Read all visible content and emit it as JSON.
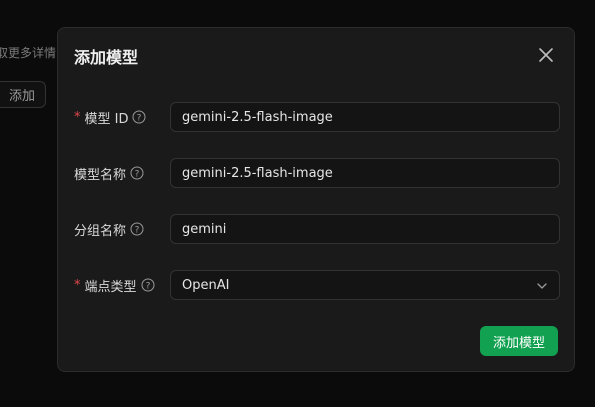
{
  "background": {
    "partial_text": "取更多详情",
    "add_button_label": "添加"
  },
  "modal": {
    "title": "添加模型",
    "fields": [
      {
        "label": "模型 ID",
        "required": true,
        "value": "gemini-2.5-flash-image"
      },
      {
        "label": "模型名称",
        "required": false,
        "value": "gemini-2.5-flash-image"
      },
      {
        "label": "分组名称",
        "required": false,
        "value": "gemini"
      },
      {
        "label": "端点类型",
        "required": true,
        "value": "OpenAI"
      }
    ],
    "submit_label": "添加模型"
  },
  "icons": [
    "close-icon",
    "help-icon",
    "chevron-down-icon"
  ],
  "colors": {
    "accent": "#12a150",
    "required": "#e5484d",
    "modal_bg": "#1a1a1a",
    "page_bg": "#0b0b0b"
  }
}
